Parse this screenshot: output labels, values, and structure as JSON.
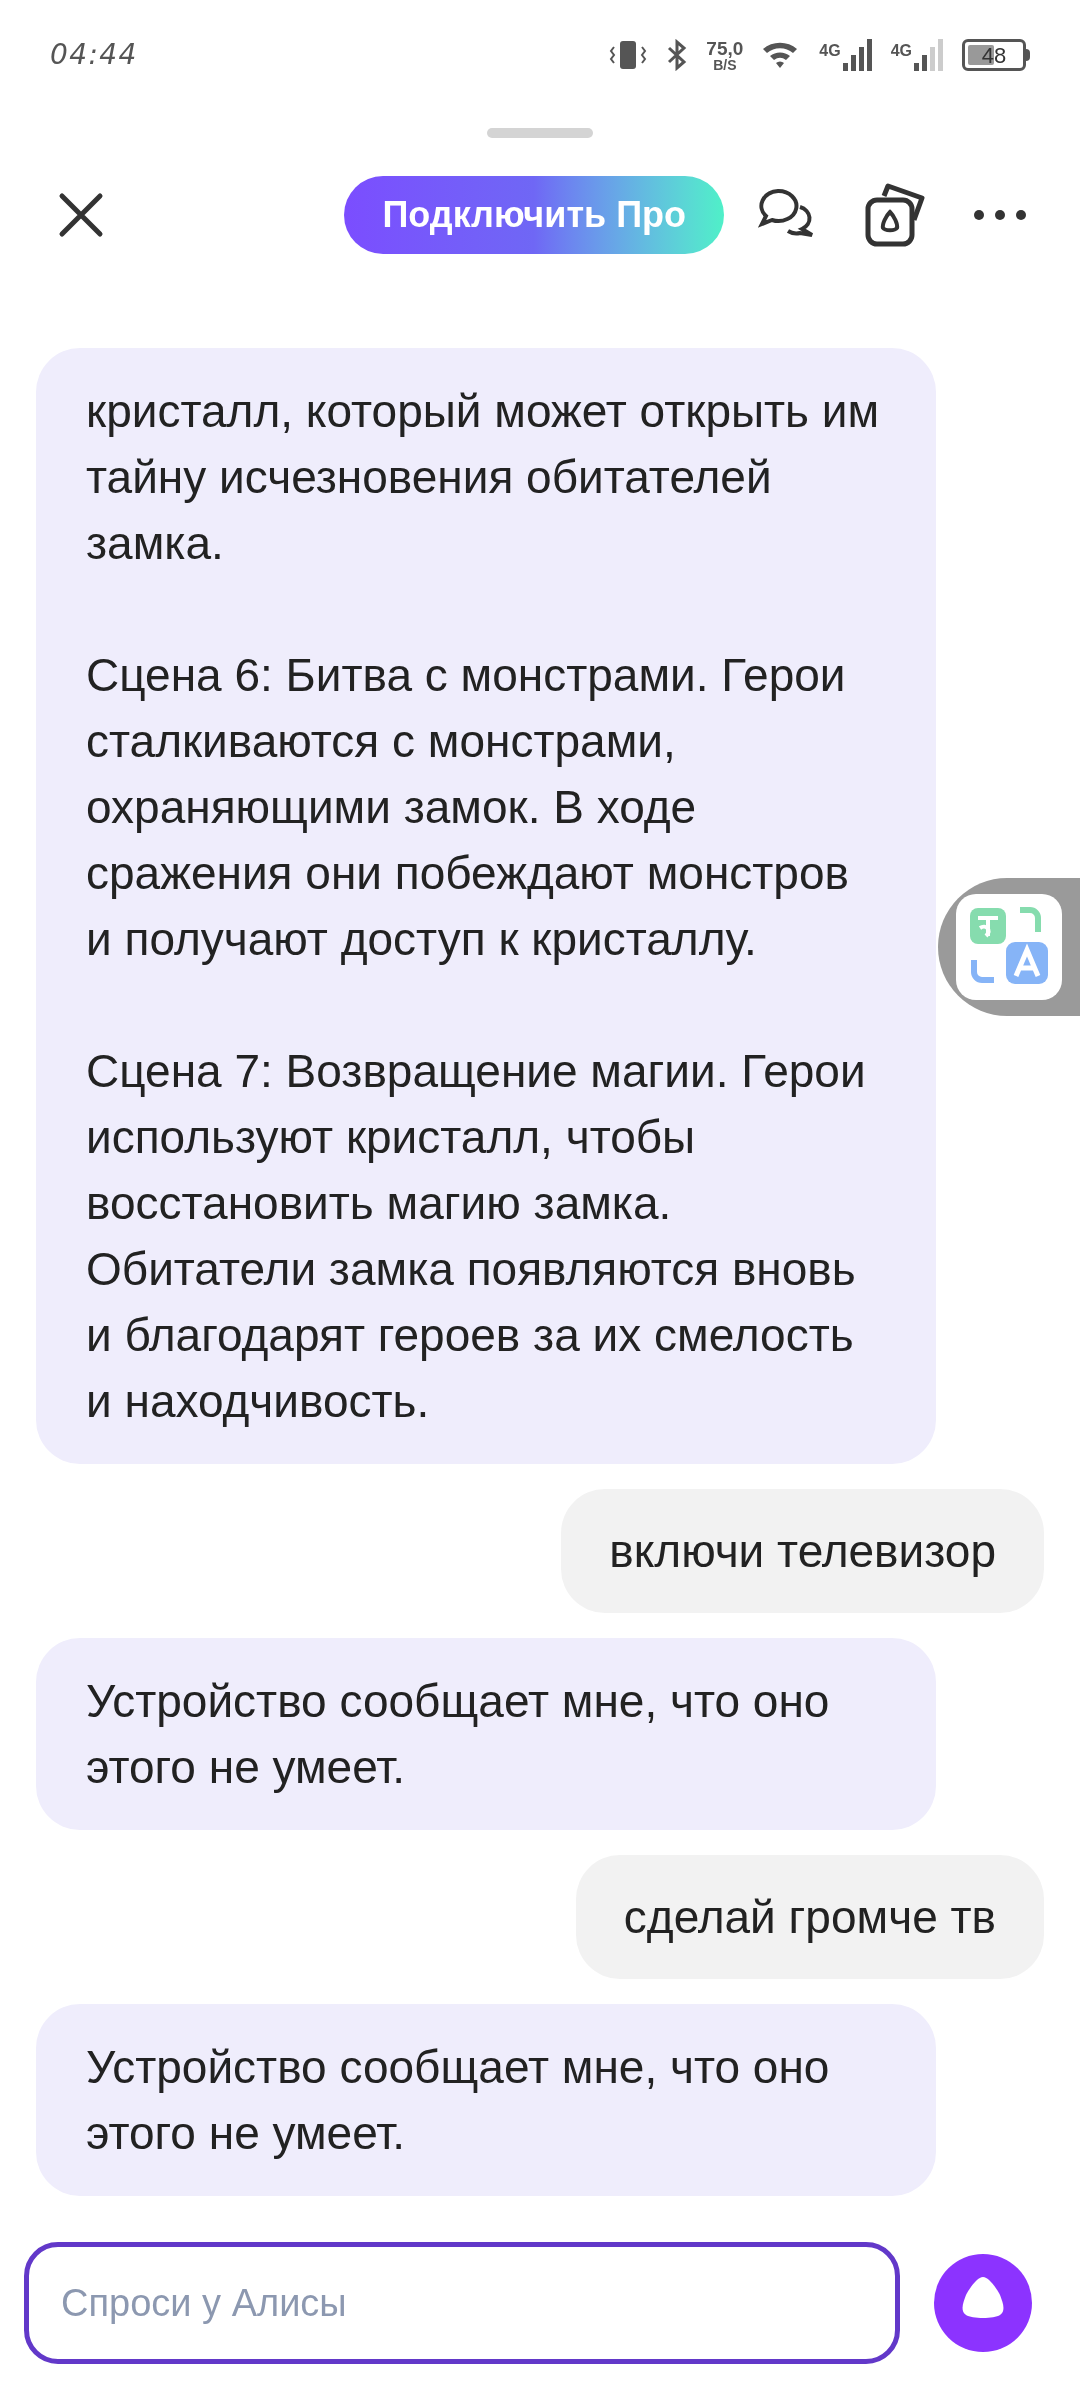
{
  "status_bar": {
    "time": "04:44",
    "speed_value": "75,0",
    "speed_unit": "B/S",
    "network_1": "4G",
    "network_2": "4G",
    "battery": "48"
  },
  "header": {
    "pro_button": "Подключить Про"
  },
  "messages": [
    {
      "kind": "assistant",
      "paragraphs": [
        "кристалл, который может открыть им тайну исчезновения обитателей замка.",
        "Сцена 6: Битва с монстрами. Герои сталкиваются с монстрами, охраняющими замок. В ходе сражения они побеждают монстров и получают доступ к кристаллу.",
        "Сцена 7: Возвращение магии. Герои используют кристалл, чтобы восстановить магию замка. Обитатели замка появляются вновь и благодарят героев за их смелость и находчивость."
      ]
    },
    {
      "kind": "user",
      "paragraphs": [
        "включи телевизор"
      ]
    },
    {
      "kind": "assistant",
      "paragraphs": [
        "Устройство сообщает мне, что оно этого не умеет."
      ]
    },
    {
      "kind": "user",
      "paragraphs": [
        "сделай громче тв"
      ]
    },
    {
      "kind": "assistant",
      "paragraphs": [
        "Устройство сообщает мне, что оно этого не умеет."
      ]
    }
  ],
  "input": {
    "placeholder": "Спроси у Алисы"
  }
}
